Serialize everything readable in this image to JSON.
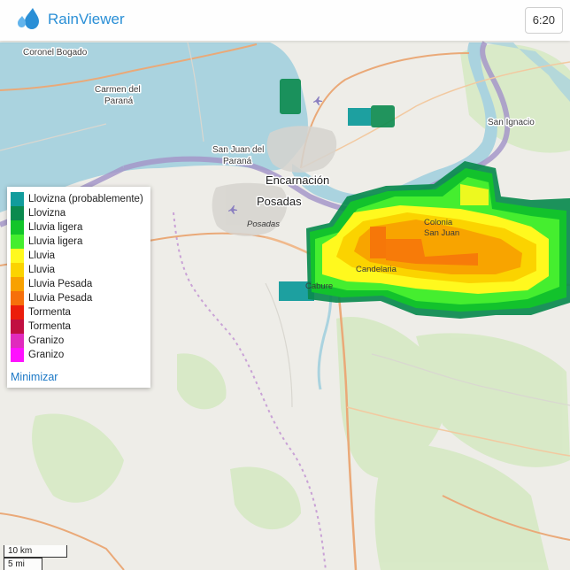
{
  "app": {
    "title": "RainViewer",
    "time": "6:20"
  },
  "map": {
    "places": {
      "coronel_bogado": "Coronel Bogado",
      "carmen_line1": "Carmen del",
      "carmen_line2": "Paraná",
      "san_juan_line1": "San Juan del",
      "san_juan_line2": "Paraná",
      "encarnacion": "Encarnación",
      "posadas": "Posadas",
      "posadas_small": "Posadas",
      "san_ignacio": "San Ignacio",
      "candelaria": "Candelaria",
      "colonia_san_juan_1": "Colonia",
      "colonia_san_juan_2": "San Juan",
      "cabure": "Cabure"
    },
    "scale": {
      "km": "10 km",
      "mi": "5 mi"
    }
  },
  "legend": {
    "items": [
      {
        "label": "Llovizna (probablemente)",
        "color": "#119c9c"
      },
      {
        "label": "Llovizna",
        "color": "#0a8a4e"
      },
      {
        "label": "Lluvia ligera",
        "color": "#12c52a"
      },
      {
        "label": "Lluvia ligera",
        "color": "#45ee2f"
      },
      {
        "label": "Lluvia",
        "color": "#fff91e"
      },
      {
        "label": "Lluvia",
        "color": "#fbd300"
      },
      {
        "label": "Lluvia Pesada",
        "color": "#f8a100"
      },
      {
        "label": "Lluvia Pesada",
        "color": "#f6700b"
      },
      {
        "label": "Tormenta",
        "color": "#eb1d0b"
      },
      {
        "label": "Tormenta",
        "color": "#c10f41"
      },
      {
        "label": "Granizo",
        "color": "#e02bbd"
      },
      {
        "label": "Granizo",
        "color": "#ff11ff"
      }
    ],
    "minimize_label": "Minimizar"
  }
}
